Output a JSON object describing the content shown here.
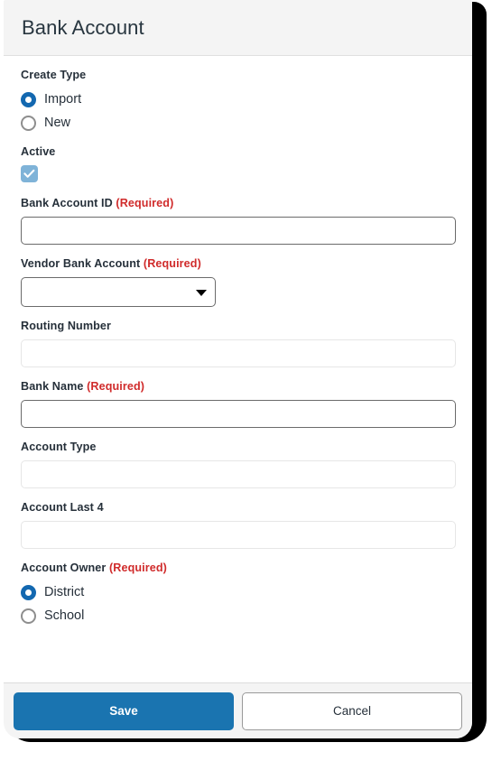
{
  "dialog": {
    "title": "Bank Account"
  },
  "form": {
    "create_type": {
      "label": "Create Type",
      "options": [
        {
          "label": "Import",
          "selected": true
        },
        {
          "label": "New",
          "selected": false
        }
      ]
    },
    "active": {
      "label": "Active",
      "checked": true,
      "icon": "check-icon"
    },
    "bank_account_id": {
      "label": "Bank Account ID",
      "required_text": "(Required)",
      "value": "",
      "placeholder": "",
      "readonly": false
    },
    "vendor_bank_account": {
      "label": "Vendor Bank Account",
      "required_text": "(Required)",
      "value": "",
      "selected_option": "",
      "options": [
        ""
      ],
      "arrow_icon": "chevron-down-icon"
    },
    "routing_number": {
      "label": "Routing Number",
      "required_text": "",
      "value": "",
      "placeholder": "",
      "readonly": true
    },
    "bank_name": {
      "label": "Bank Name",
      "required_text": "(Required)",
      "value": "",
      "placeholder": "",
      "readonly": false
    },
    "account_type": {
      "label": "Account Type",
      "required_text": "",
      "value": "",
      "placeholder": "",
      "readonly": true
    },
    "account_last_4": {
      "label": "Account Last 4",
      "required_text": "",
      "value": "",
      "placeholder": "",
      "readonly": true
    },
    "account_owner": {
      "label": "Account Owner",
      "required_text": "(Required)",
      "options": [
        {
          "label": "District",
          "selected": true
        },
        {
          "label": "School",
          "selected": false
        }
      ]
    }
  },
  "footer": {
    "save_label": "Save",
    "cancel_label": "Cancel"
  },
  "colors": {
    "primary_blue": "#1a74b0",
    "radio_blue": "#1368b0",
    "checkbox_blue": "#7fb3d8",
    "required_red": "#d02b2b",
    "header_bg": "#f4f4f4",
    "text": "#26303a"
  }
}
